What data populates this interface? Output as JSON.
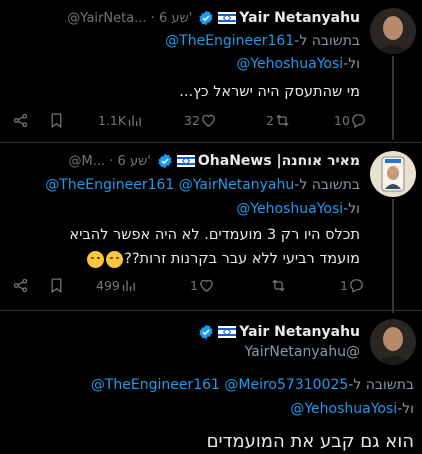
{
  "tweets": [
    {
      "name": "Yair Netanyahu",
      "meta": "@YairNeta... · 6 שע'",
      "reply_prefix": "בתשובה ל-",
      "mention1": "@TheEngineer161",
      "and_prefix": "ול-",
      "mention2": "@YehoshuaYosi",
      "text": "מי שהתעסק היה ישראל כץ...",
      "replies": "10",
      "retweets": "2",
      "likes": "32",
      "views": "1.1K"
    },
    {
      "name": "מאיר אוחנה| OhaNews",
      "meta": "@M... · 6 שע'",
      "reply_prefix": "בתשובה ל-",
      "mention0": "@YairNetanyahu",
      "mention1": "@TheEngineer161",
      "and_prefix": "ול-",
      "mention2": "@YehoshuaYosi",
      "text_line1": "תכלס היו רק 3 מועמדים. לא היה אפשר להביא",
      "text_line2": "מועמד רביעי ללא עבר בקרנות זרות??",
      "replies": "1",
      "retweets": "",
      "likes": "1",
      "views": "499"
    },
    {
      "name": "Yair Netanyahu",
      "handle": "@YairNetanyahu",
      "reply_prefix": "בתשובה ל-",
      "mention0": "@Meiro57310025",
      "mention1": "@TheEngineer161",
      "and_prefix": "ול-",
      "mention2": "@YehoshuaYosi",
      "text": "הוא גם קבע את המועמדים"
    }
  ],
  "icons": {
    "reply": "reply-icon",
    "retweet": "retweet-icon",
    "like": "like-icon",
    "views": "views-icon",
    "bookmark": "bookmark-icon",
    "share": "share-icon",
    "verified": "verified-badge-icon",
    "flag": "israel-flag-icon"
  },
  "colors": {
    "background": "#000000",
    "link": "#1d9bf0",
    "muted": "#71767b",
    "text": "#e7e9ea"
  }
}
